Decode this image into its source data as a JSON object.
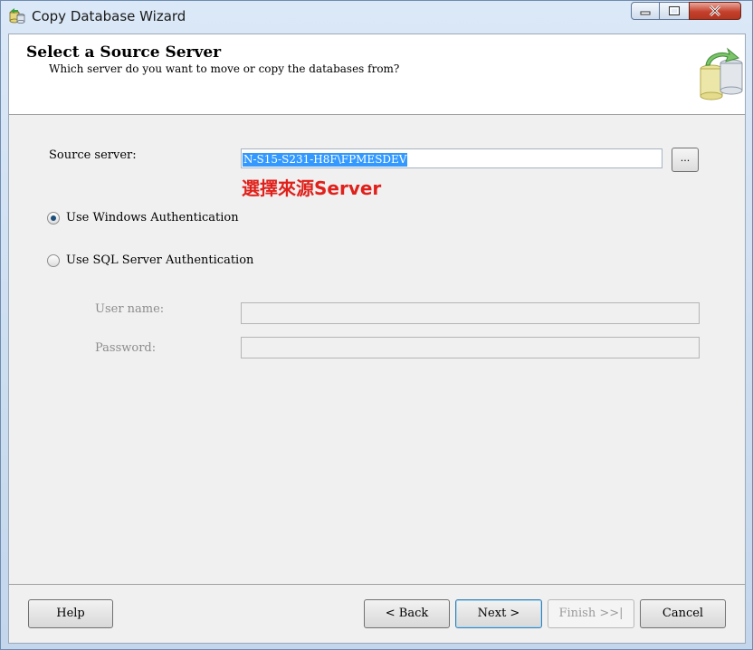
{
  "window": {
    "title": "Copy Database Wizard"
  },
  "header": {
    "title": "Select a Source Server",
    "subtitle": "Which server do you want to move or copy the databases from?"
  },
  "form": {
    "source_server_label": "Source server:",
    "source_server_value": "N-S15-S231-H8F\\FPMESDEV",
    "browse_label": "...",
    "annotation": "選擇來源Server",
    "auth_options": [
      {
        "label": "Use Windows Authentication",
        "selected": true
      },
      {
        "label": "Use SQL Server Authentication",
        "selected": false
      }
    ],
    "username_label": "User name:",
    "username_value": "",
    "password_label": "Password:",
    "password_value": ""
  },
  "footer": {
    "help": "Help",
    "back": "< Back",
    "next": "Next >",
    "finish": "Finish >>|",
    "cancel": "Cancel"
  },
  "colors": {
    "annotation": "#e0211b",
    "selection": "#3399ff"
  },
  "icons": [
    "app-database-icon",
    "minimize-icon",
    "maximize-icon",
    "close-icon",
    "header-database-icon"
  ]
}
